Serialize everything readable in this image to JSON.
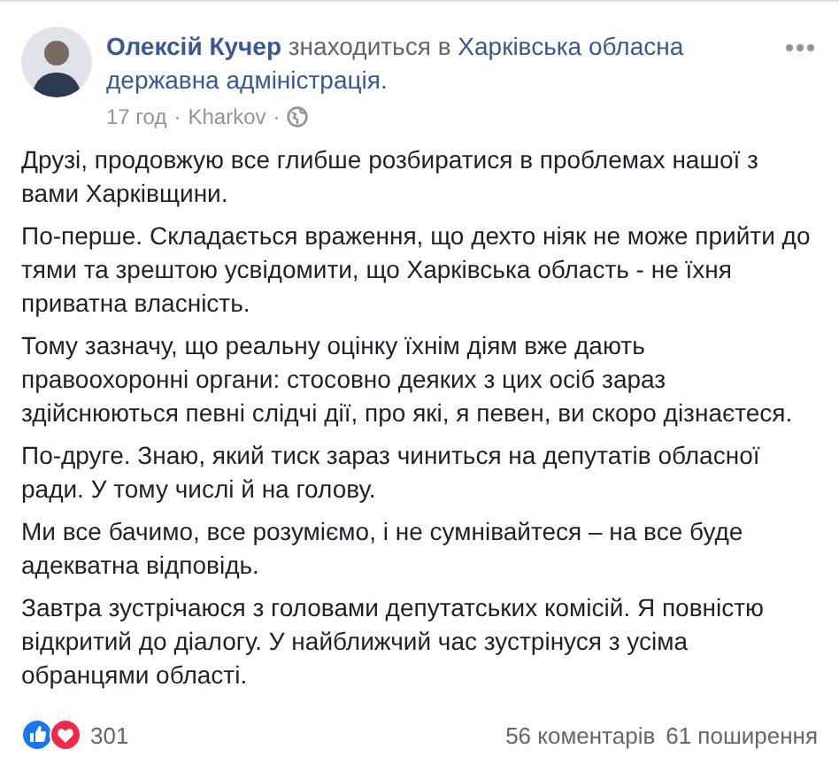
{
  "post": {
    "author": "Олексій Кучер",
    "action": "знаходиться в",
    "place": "Харківська обласна державна адміністрація.",
    "time": "17 год",
    "location": "Kharkov",
    "separator": "·",
    "paragraphs": [
      "Друзі, продовжую все глибше розбиратися в проблемах нашої з вами Харківщини.",
      "По-перше. Складається враження, що дехто ніяк не може прийти до тями та зрештою усвідомити, що Харківська область - не їхня приватна власність.",
      "Тому зазначу, що реальну оцінку їхнім діям вже дають правоохоронні органи: стосовно деяких з цих осіб зараз здійснюються певні слідчі дії, про які, я певен, ви скоро дізнаєтеся.",
      "По-друге. Знаю, який тиск зараз чиниться на депутатів обласної ради. У тому числі й на голову.",
      "Ми все бачимо, все розуміємо, і не сумнівайтеся – на все буде адекватна відповідь.",
      "Завтра зустрічаюся з головами депутатських комісій. Я повністю відкритий до діалогу. У найближчий час зустрінуся з усіма обранцями області."
    ]
  },
  "footer": {
    "reactions": [
      {
        "kind": "like"
      },
      {
        "kind": "love"
      }
    ],
    "reaction_count": "301",
    "comments": "56 коментарів",
    "shares": "61 поширення"
  }
}
